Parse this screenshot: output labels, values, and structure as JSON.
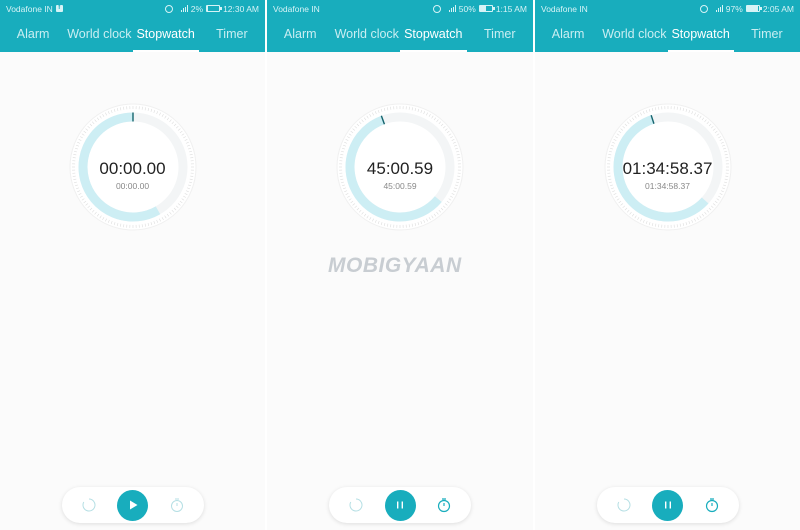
{
  "accent_color": "#18adbd",
  "tabs": [
    "Alarm",
    "World clock",
    "Stopwatch",
    "Timer"
  ],
  "active_tab": "Stopwatch",
  "watermark": "MOBIGYAAN",
  "screens": [
    {
      "status": {
        "carrier": "Vodafone IN",
        "facebook_notification": "f",
        "alarm_icon": "alarm-clock-icon",
        "battery": "2%",
        "time": "12:30 AM"
      },
      "tabs": [
        "Alarm",
        "World clock",
        "Stopwatch",
        "Timer"
      ],
      "stopwatch": {
        "main_time": "00:00.00",
        "sub_time": "00:00.00",
        "state": "stopped"
      },
      "controls": {
        "left": "lap-reset-icon",
        "center": "play-icon",
        "right": "lap-stopwatch-icon",
        "left_enabled": false,
        "right_enabled": false
      }
    },
    {
      "status": {
        "carrier": "Vodafone IN",
        "alarm_icon": "alarm-clock-icon",
        "battery": "50%",
        "time": "1:15 AM"
      },
      "tabs": [
        "Alarm",
        "World clock",
        "Stopwatch",
        "Timer"
      ],
      "stopwatch": {
        "main_time": "45:00.59",
        "sub_time": "45:00.59",
        "state": "running"
      },
      "controls": {
        "left": "lap-reset-icon",
        "center": "pause-icon",
        "right": "lap-stopwatch-icon",
        "left_enabled": false,
        "right_enabled": true
      }
    },
    {
      "status": {
        "carrier": "Vodafone IN",
        "alarm_icon": "alarm-clock-icon",
        "battery": "97%",
        "time": "2:05 AM"
      },
      "tabs": [
        "Alarm",
        "World clock",
        "Stopwatch",
        "Timer"
      ],
      "stopwatch": {
        "main_time": "01:34:58.37",
        "sub_time": "01:34:58.37",
        "state": "running"
      },
      "controls": {
        "left": "lap-reset-icon",
        "center": "pause-icon",
        "right": "lap-stopwatch-icon",
        "left_enabled": false,
        "right_enabled": true
      }
    }
  ]
}
